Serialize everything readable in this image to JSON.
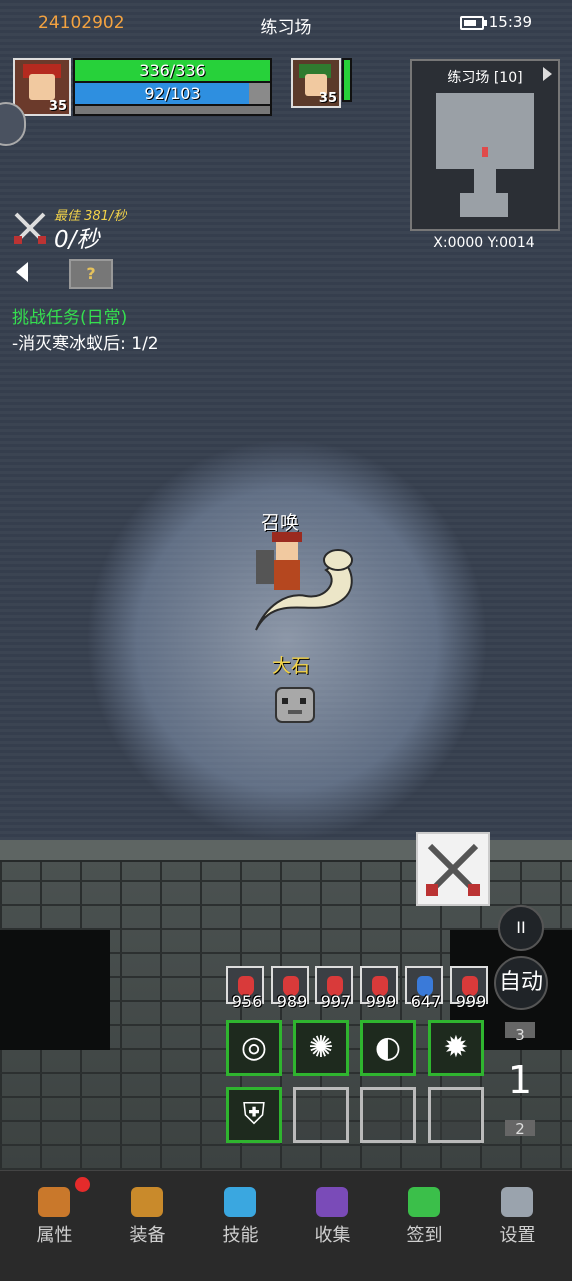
{
  "status_bar": {
    "player_id": "24102902",
    "area_title": "练习场",
    "time": "15:39"
  },
  "player": {
    "level": "35",
    "hp": "336/336",
    "hp_fraction": 1.0,
    "mp": "92/103",
    "mp_fraction": 0.893,
    "exp_fraction": 0.0
  },
  "pet": {
    "level": "35"
  },
  "minimap": {
    "title": "练习场 [10]",
    "coords": "X:0000  Y:0014"
  },
  "dps": {
    "best": "最佳 381/秒",
    "current": "0/秒"
  },
  "help_box": {
    "symbol": "?"
  },
  "quest": {
    "title": "挑战任务(日常)",
    "line": "-消灭寒冰蚁后: 1/2"
  },
  "scene": {
    "summon_label": "召唤",
    "enemy_label": "大石"
  },
  "potions": [
    {
      "count": "956",
      "color": "#d93a3a"
    },
    {
      "count": "989",
      "color": "#d93a3a"
    },
    {
      "count": "997",
      "color": "#d93a3a"
    },
    {
      "count": "999",
      "color": "#d93a3a"
    },
    {
      "count": "647",
      "color": "#3a7ad9"
    },
    {
      "count": "999",
      "color": "#d93a3a"
    }
  ],
  "skills": [
    {
      "symbol": "◎",
      "name": "swirl-skill-icon"
    },
    {
      "symbol": "✺",
      "name": "burst-skill-icon"
    },
    {
      "symbol": "◐",
      "name": "slash-skill-icon"
    },
    {
      "symbol": "✹",
      "name": "star-skill-icon"
    },
    {
      "symbol": "⛨",
      "name": "shield-skill-icon"
    }
  ],
  "controls": {
    "pause_symbol": "II",
    "auto_label": "自动",
    "floor_up": "3",
    "floor_current": "1",
    "floor_down": "2"
  },
  "nav": [
    {
      "label": "属性",
      "color": "#c9782b"
    },
    {
      "label": "装备",
      "color": "#c98a2b"
    },
    {
      "label": "技能",
      "color": "#3aa7e0"
    },
    {
      "label": "收集",
      "color": "#7a4bb8"
    },
    {
      "label": "签到",
      "color": "#3bbf4a"
    },
    {
      "label": "设置",
      "color": "#9aa3ad"
    }
  ]
}
